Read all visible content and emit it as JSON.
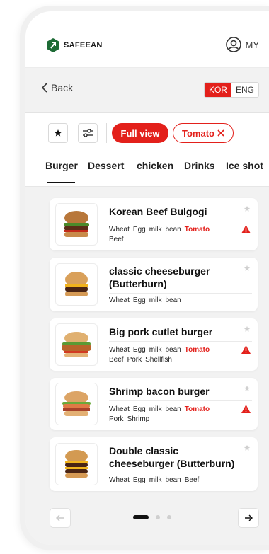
{
  "header": {
    "brand": "SAFEEAN",
    "account_label": "MY"
  },
  "nav": {
    "back_label": "Back",
    "lang_active": "KOR",
    "lang_inactive": "ENG"
  },
  "filters": {
    "full_view_label": "Full view",
    "tomato_label": "Tomato"
  },
  "tabs": [
    "Burger",
    "Dessert",
    "chicken",
    "Drinks",
    "Ice shot"
  ],
  "products": [
    {
      "title_lines": [
        "Korean Beef Bulgogi"
      ],
      "ingredients_line1": [
        "Wheat",
        "Egg",
        "milk",
        "bean"
      ],
      "highlight": "Tomato",
      "ingredients_line2": [
        "Beef"
      ],
      "warning": true
    },
    {
      "title_lines": [
        "classic cheeseburger",
        "(Butterburn)"
      ],
      "ingredients_line1": [
        "Wheat",
        "Egg",
        "milk",
        "bean"
      ],
      "highlight": "",
      "ingredients_line2": [],
      "warning": false
    },
    {
      "title_lines": [
        "Big pork cutlet burger"
      ],
      "ingredients_line1": [
        "Wheat",
        "Egg",
        "milk",
        "bean"
      ],
      "highlight": "Tomato",
      "ingredients_line2": [
        "Beef",
        "Pork",
        "Shellfish"
      ],
      "warning": true
    },
    {
      "title_lines": [
        "Shrimp bacon burger"
      ],
      "ingredients_line1": [
        "Wheat",
        "Egg",
        "milk",
        "bean"
      ],
      "highlight": "Tomato",
      "ingredients_line2": [
        "Pork",
        "Shrimp"
      ],
      "warning": true
    },
    {
      "title_lines": [
        "Double classic",
        "cheeseburger (Butterburn)"
      ],
      "ingredients_line1": [
        "Wheat",
        "Egg",
        "milk",
        "bean",
        "Beef"
      ],
      "highlight": "",
      "ingredients_line2": [],
      "warning": false
    }
  ],
  "pagination": {
    "active_page": 1,
    "total_pages": 3
  },
  "colors": {
    "accent": "#e3201b",
    "brand": "#1d6b35"
  },
  "icons": [
    "logo-mark",
    "user-icon",
    "chevron-left-icon",
    "star-icon",
    "sliders-icon",
    "close-icon",
    "warning-icon",
    "arrow-left-icon",
    "arrow-right-icon"
  ]
}
